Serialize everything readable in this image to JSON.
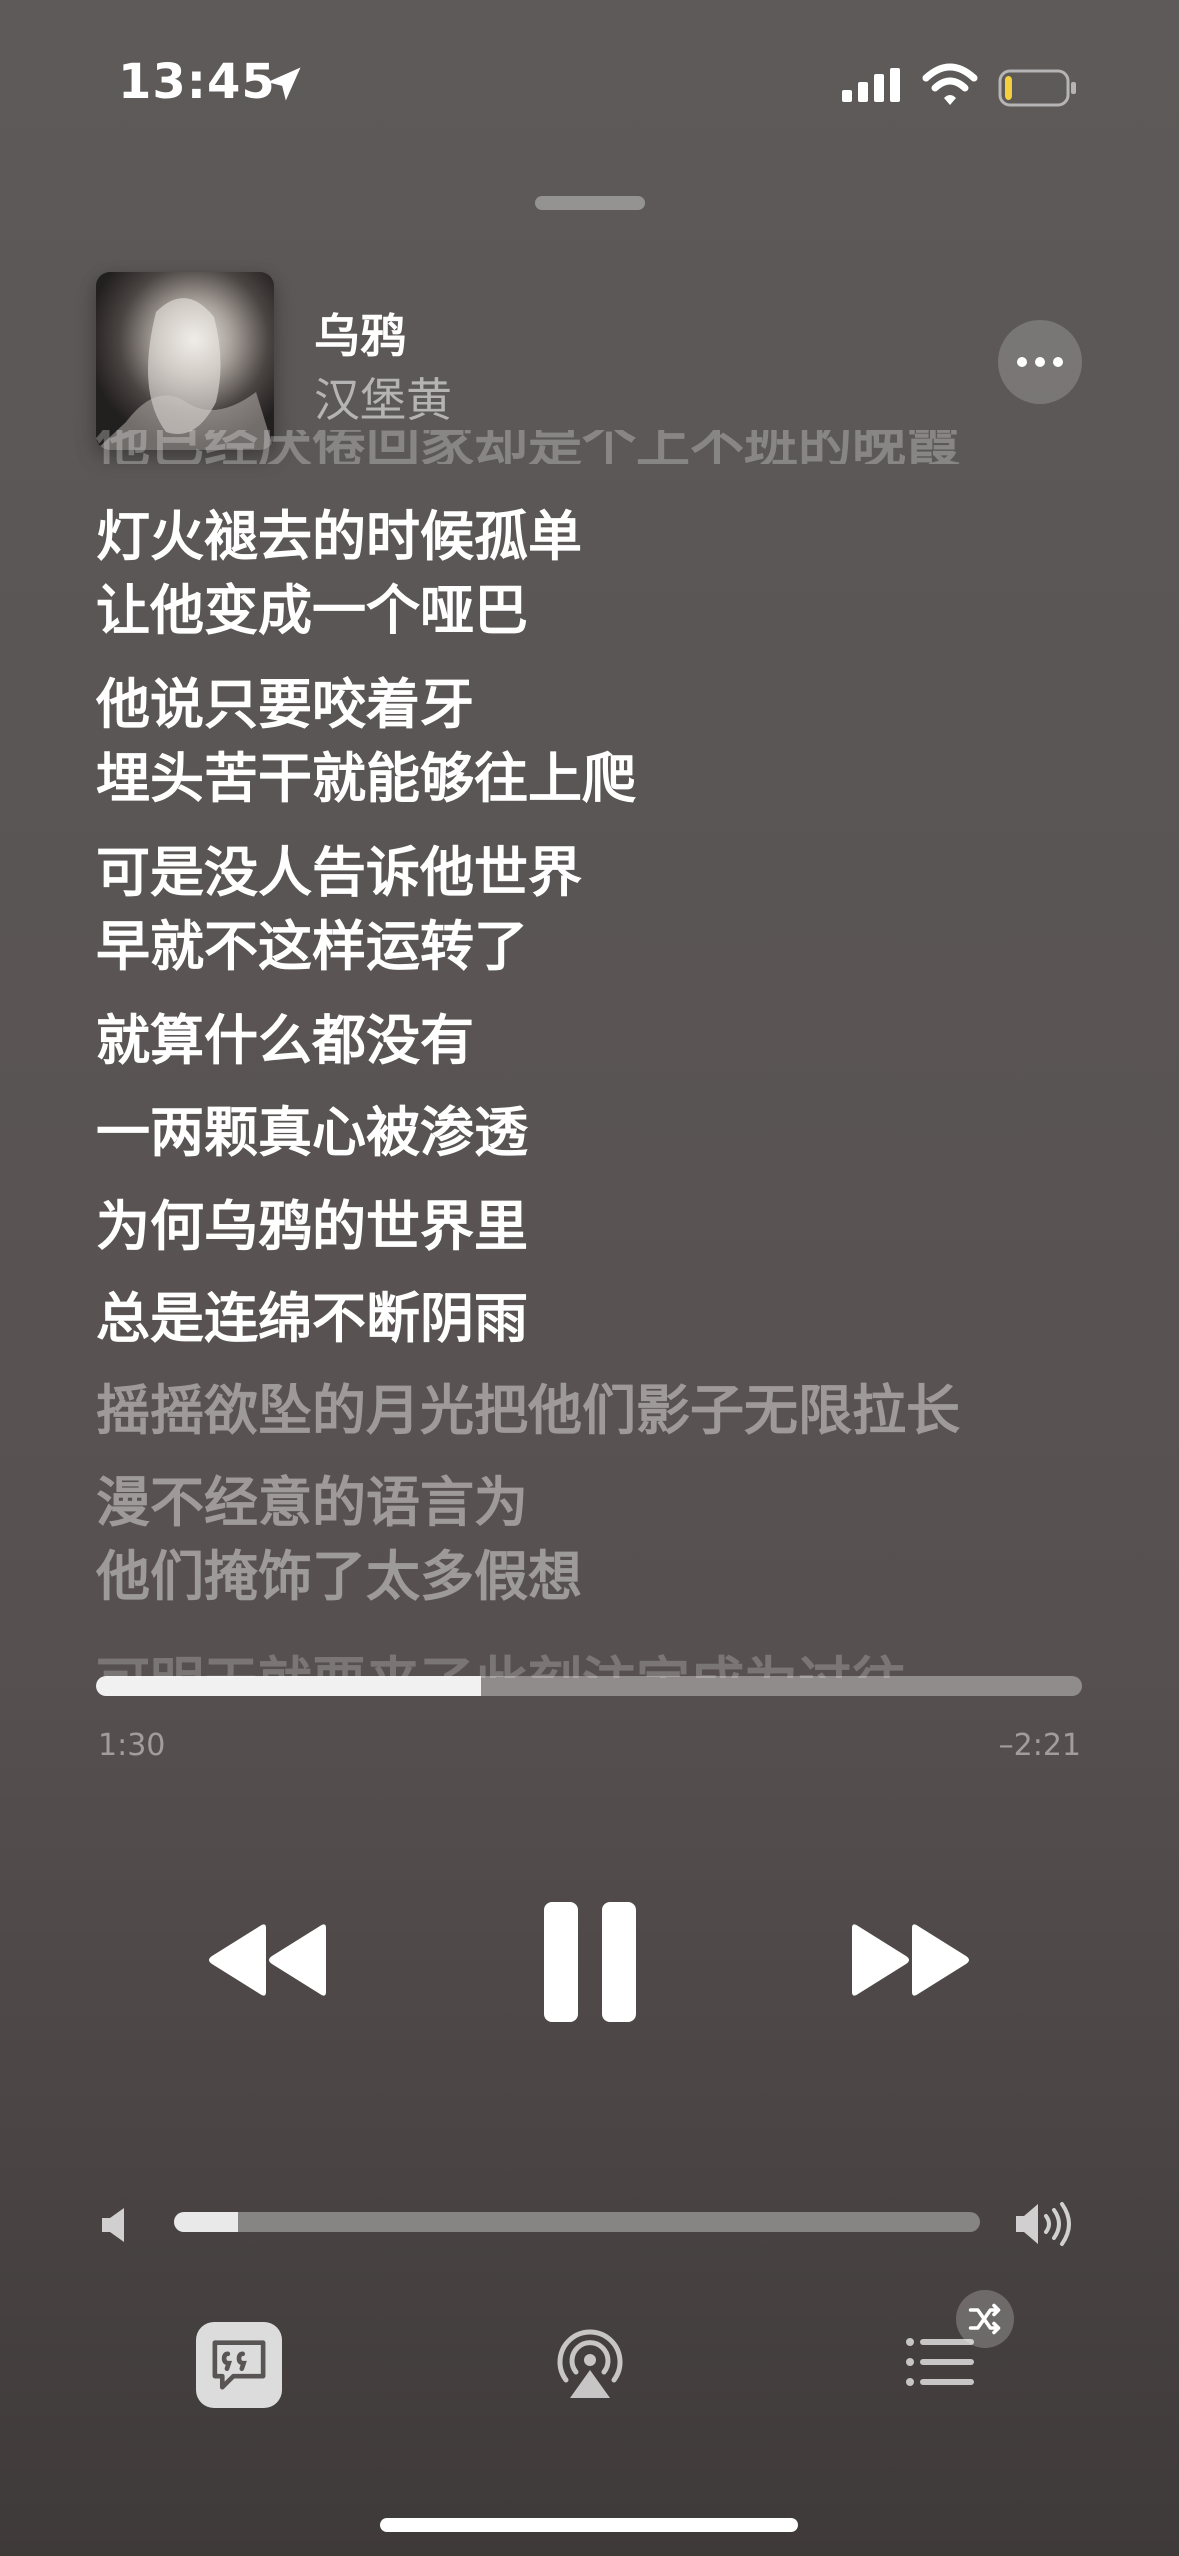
{
  "status_bar": {
    "time": "13:45",
    "battery_level": 0.12,
    "battery_color": "#f4d03f"
  },
  "now_playing": {
    "title": "乌鸦",
    "artist": "汉堡黄",
    "more_icon": "ellipsis-icon"
  },
  "lyrics": {
    "clipped_top": "他已经厌倦回家却是个上不班的晚霞",
    "lines": [
      {
        "text": "灯火褪去的时候孤单",
        "active": true
      },
      {
        "text": "让他变成一个哑巴",
        "active": true
      },
      {
        "text": "他说只要咬着牙",
        "active": true
      },
      {
        "text": "埋头苦干就能够往上爬",
        "active": true
      },
      {
        "text": "可是没人告诉他世界",
        "active": true
      },
      {
        "text": "早就不这样运转了",
        "active": true
      },
      {
        "text": "就算什么都没有",
        "active": true
      },
      {
        "text": "一两颗真心被渗透",
        "active": true
      },
      {
        "text": "为何乌鸦的世界里",
        "active": true
      },
      {
        "text": "总是连绵不断阴雨",
        "active": true
      },
      {
        "text": "摇摇欲坠的月光把他们影子无限拉长",
        "active": false
      },
      {
        "text": "漫不经意的语言为",
        "active": false
      },
      {
        "text": "他们掩饰了太多假想",
        "active": false
      }
    ],
    "clipped_bottom": "可明天就要来了此刻注定成为过往"
  },
  "playback": {
    "elapsed": "1:30",
    "remaining": "–2:21",
    "progress": 0.39
  },
  "controls": {
    "rewind_icon": "rewind-icon",
    "pause_icon": "pause-icon",
    "forward_icon": "fast-forward-icon"
  },
  "volume": {
    "level": 0.08
  },
  "bottom_bar": {
    "lyrics_icon": "lyrics-quote-icon",
    "airplay_icon": "airplay-icon",
    "queue_icon": "queue-list-icon",
    "shuffle_icon": "shuffle-icon"
  }
}
